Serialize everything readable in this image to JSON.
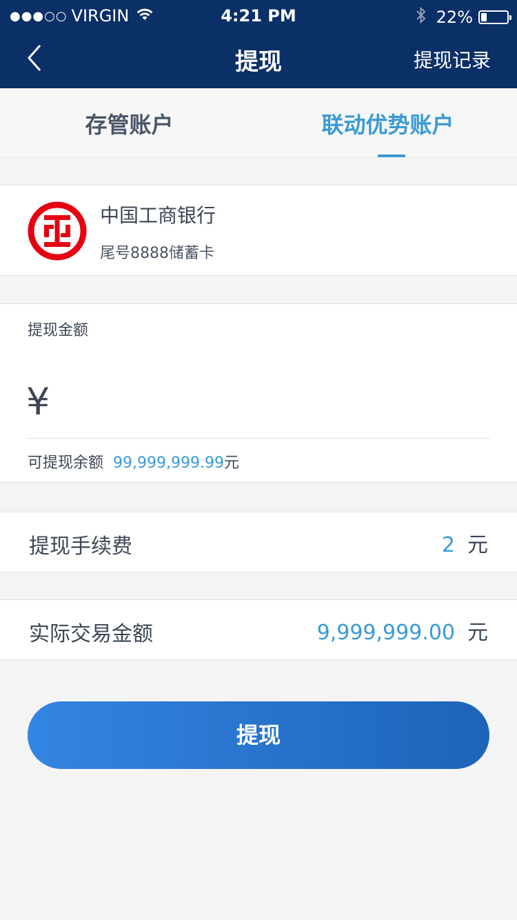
{
  "status_bar": {
    "signal_dots": "●●●○○",
    "carrier": "VIRGIN",
    "time": "4:21 PM",
    "battery_percent_text": "22%",
    "battery_level": 0.22,
    "icons": [
      "wifi-icon",
      "bluetooth-icon",
      "battery-icon"
    ]
  },
  "nav": {
    "title": "提现",
    "right_label": "提现记录",
    "back_icon": "chevron-left-icon"
  },
  "tabs": [
    {
      "label": "存管账户",
      "active": false
    },
    {
      "label": "联动优势账户",
      "active": true
    }
  ],
  "bank": {
    "name": "中国工商银行",
    "subtitle": "尾号8888储蓄卡",
    "logo": "icbc-logo"
  },
  "amount": {
    "label": "提现金额",
    "currency_symbol": "¥",
    "input_value": "",
    "balance_label": "可提现余额",
    "balance_value": "99,999,999.99",
    "balance_unit": "元"
  },
  "fee": {
    "label": "提现手续费",
    "value": "2",
    "unit": "元"
  },
  "actual": {
    "label": "实际交易金额",
    "value": "9,999,999.00",
    "unit": "元"
  },
  "submit": {
    "label": "提现"
  },
  "colors": {
    "header_bg": "#0b2f67",
    "accent": "#3a9ad4",
    "bank_red": "#e60012",
    "button_start": "#3385e3",
    "button_end": "#1d63b8"
  }
}
